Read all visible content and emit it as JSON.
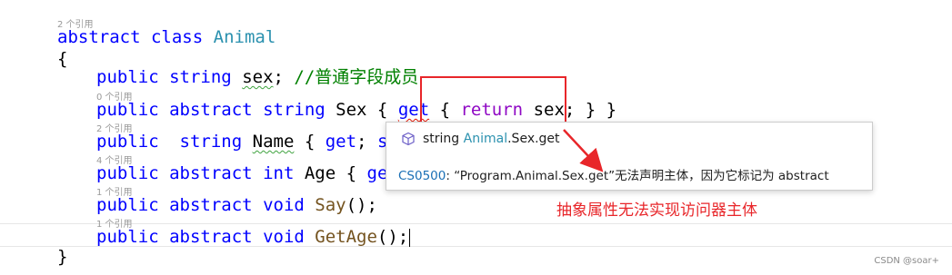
{
  "codelens": {
    "animal_refs": "2 个引用",
    "sex_get_refs": "0 个引用",
    "name_refs": "2 个引用",
    "age_refs": "4 个引用",
    "say_refs": "1 个引用",
    "getage_refs": "1 个引用"
  },
  "code": {
    "abstract": "abstract",
    "class": "class",
    "class_name": "Animal",
    "open_brace": "{",
    "close_brace": "}",
    "public": "public",
    "string": "string",
    "int": "int",
    "void": "void",
    "get": "get",
    "set": "set",
    "return": "return",
    "field_sex": "sex",
    "comment": "//普通字段成员",
    "prop_sex": "Sex",
    "prop_name": "Name",
    "prop_age": "Age",
    "method_say": "Say",
    "method_getage": "GetAge"
  },
  "tooltip": {
    "type_kw": "string",
    "member_class": "Animal",
    "member_rest": ".Sex.get",
    "error_code": "CS0500",
    "error_message": ": “Program.Animal.Sex.get”无法声明主体，因为它标记为 abstract"
  },
  "annotation": "抽象属性无法实现访问器主体",
  "watermark": "CSDN @soar+",
  "colors": {
    "keyword": "#0000ff",
    "type": "#2b91af",
    "control_keyword": "#8f08c4",
    "method": "#74531f",
    "comment": "#008000",
    "annotation_red": "#e8262a"
  }
}
